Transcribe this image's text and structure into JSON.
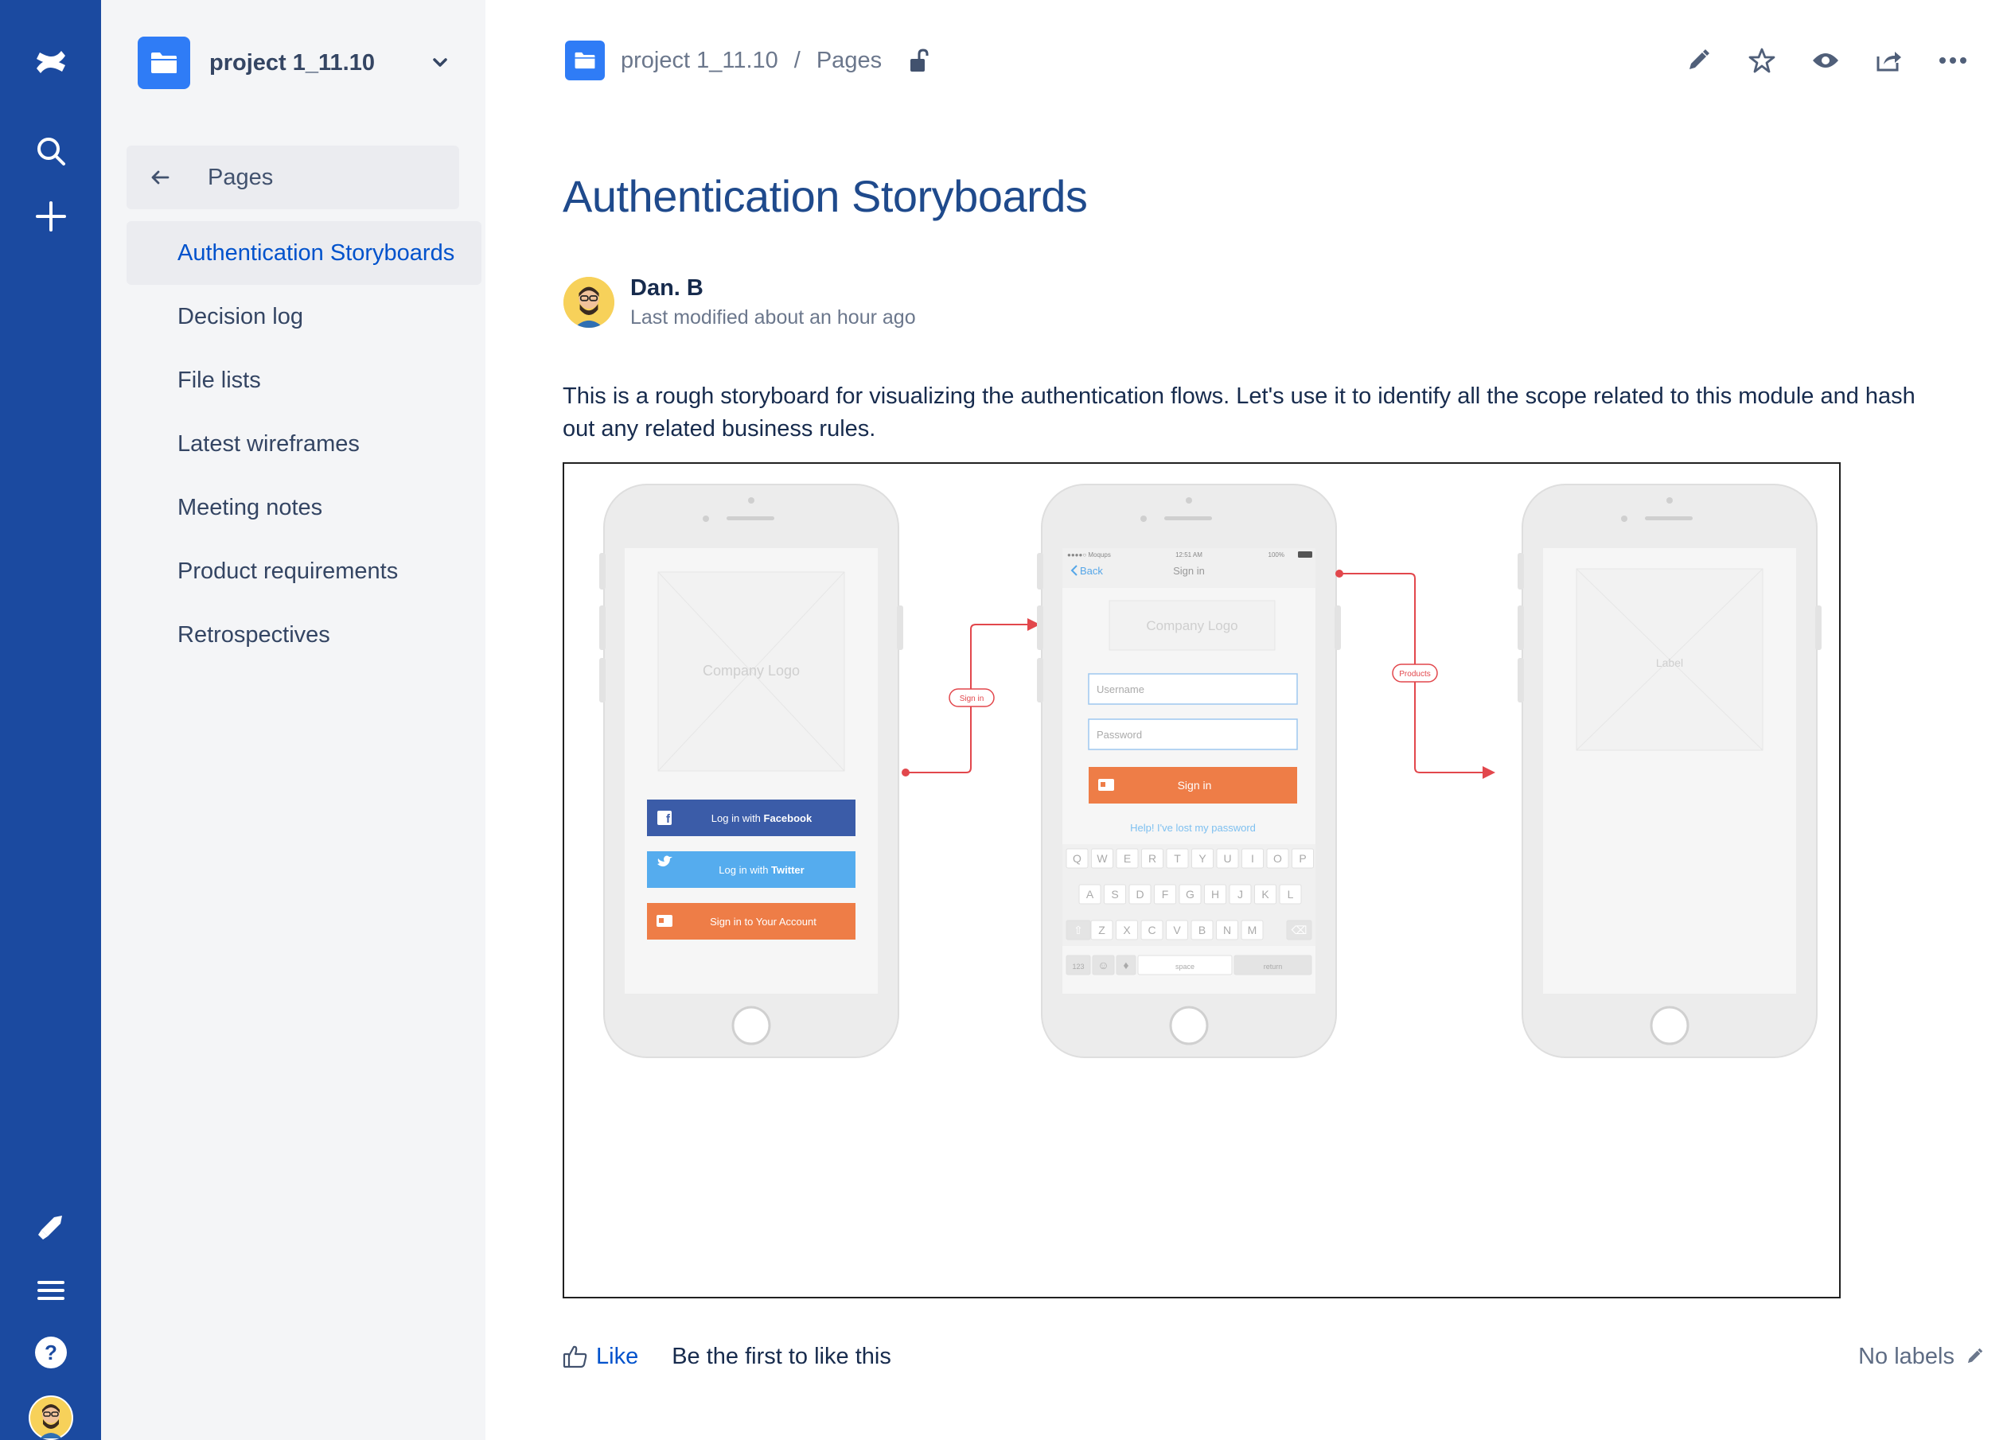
{
  "global_nav": {
    "icons": [
      "confluence-logo-icon",
      "search-icon",
      "create-icon",
      "notifications-icon",
      "menu-icon",
      "help-icon",
      "profile-avatar"
    ]
  },
  "sidebar": {
    "space_name": "project 1_11.10",
    "pages_label": "Pages",
    "items": [
      {
        "label": "Authentication Storyboards",
        "active": true
      },
      {
        "label": "Decision log",
        "active": false
      },
      {
        "label": "File lists",
        "active": false
      },
      {
        "label": "Latest wireframes",
        "active": false
      },
      {
        "label": "Meeting notes",
        "active": false
      },
      {
        "label": "Product requirements",
        "active": false
      },
      {
        "label": "Retrospectives",
        "active": false
      }
    ]
  },
  "breadcrumb": {
    "space": "project 1_11.10",
    "separator": "/",
    "section": "Pages"
  },
  "toolbar": {
    "icons": [
      "edit-icon",
      "star-icon",
      "watch-icon",
      "share-icon",
      "more-icon"
    ]
  },
  "page": {
    "title": "Authentication Storyboards",
    "author": "Dan. B",
    "modified": "Last modified about an hour ago",
    "body": "This is a rough storyboard for visualizing the authentication flows. Let's use it to identify all the scope related to this module and hash out any related business rules."
  },
  "storyboard": {
    "phone1": {
      "logo_placeholder": "Company Logo",
      "facebook_prefix": "Log in with ",
      "facebook_bold": "Facebook",
      "twitter_prefix": "Log in with ",
      "twitter_bold": "Twitter",
      "account_button": "Sign in to Your Account"
    },
    "connector1": "Sign in",
    "phone2": {
      "status_carrier": "●●●●○ Moqups",
      "status_time": "12:51 AM",
      "status_battery": "100%",
      "back": "Back",
      "title": "Sign in",
      "logo_placeholder": "Company Logo",
      "username_placeholder": "Username",
      "password_placeholder": "Password",
      "signin_button": "Sign in",
      "forgot_link": "Help! I've lost my password",
      "keyboard_row1": [
        "Q",
        "W",
        "E",
        "R",
        "T",
        "Y",
        "U",
        "I",
        "O",
        "P"
      ],
      "keyboard_row2": [
        "A",
        "S",
        "D",
        "F",
        "G",
        "H",
        "J",
        "K",
        "L"
      ],
      "keyboard_row3": [
        "Z",
        "X",
        "C",
        "V",
        "B",
        "N",
        "M"
      ],
      "key_123": "123",
      "key_space": "space",
      "key_return": "return"
    },
    "connector2": "Products",
    "phone3": {
      "label_placeholder": "Label"
    }
  },
  "footer": {
    "like": "Like",
    "like_note": "Be the first to like this",
    "labels": "No labels"
  },
  "colors": {
    "global_nav": "#1b4aa0",
    "sidebar_bg": "#f4f5f7",
    "link_blue": "#0052cc",
    "title_blue": "#1f4a8c",
    "facebook": "#3b5ca8",
    "twitter": "#55acee",
    "orange": "#ee7d47",
    "connector_red": "#e2474c"
  }
}
